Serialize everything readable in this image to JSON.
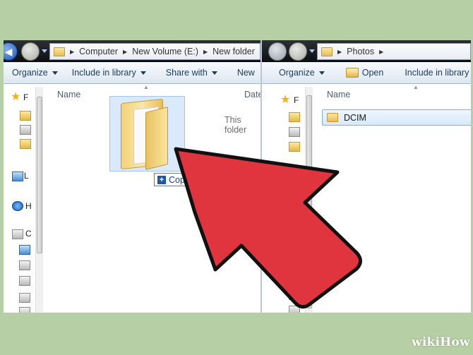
{
  "left_window": {
    "breadcrumb": [
      "Computer",
      "New Volume (E:)",
      "New folder"
    ],
    "toolbar": {
      "organize": "Organize",
      "include_in_library": "Include in library",
      "share_with": "Share with",
      "new": "New"
    },
    "columns": {
      "name": "Name",
      "date": "Date"
    },
    "empty_message": "This folder",
    "nav_letters": [
      "F",
      "L",
      "H",
      "C"
    ]
  },
  "right_window": {
    "breadcrumb": [
      "Photos"
    ],
    "toolbar": {
      "organize": "Organize",
      "open": "Open",
      "include_in_library": "Include in library"
    },
    "columns": {
      "name": "Name"
    },
    "items": [
      {
        "name": "DCIM"
      }
    ],
    "nav_letters": [
      "F"
    ]
  },
  "drag": {
    "tooltip": "Copy"
  },
  "watermark": "wikiHow",
  "colors": {
    "background": "#b6cfa4",
    "arrow_fill": "#e0353f",
    "arrow_stroke": "#111111",
    "selection": "#d8e9fb"
  }
}
